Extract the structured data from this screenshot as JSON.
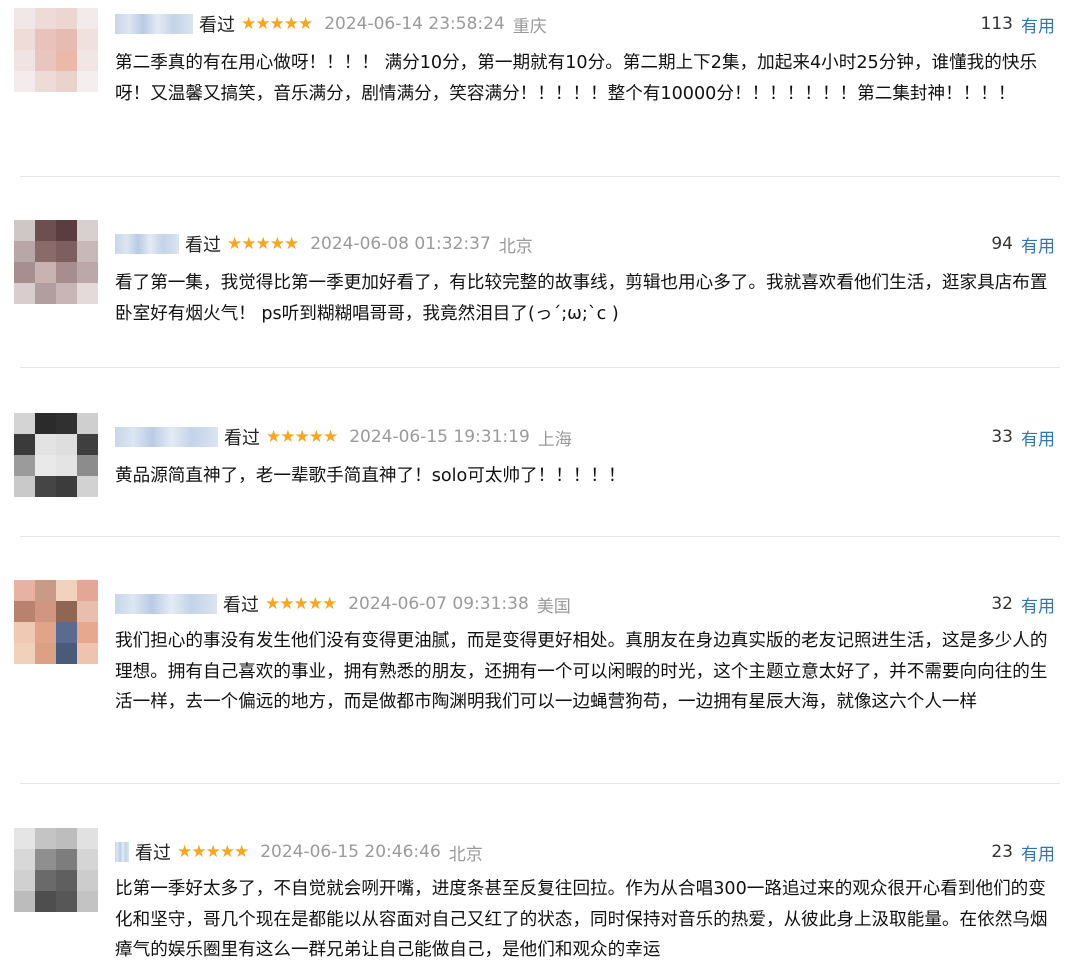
{
  "reviews": [
    {
      "watched_label": "看过",
      "stars": "★★★★★",
      "time": "2024-06-14 23:58:24",
      "location": "重庆",
      "vote_count": "113",
      "useful_label": "有用",
      "content": "第二季真的有在用心做呀！！！！ 满分10分，第一期就有10分。第二期上下2集，加起来4小时25分钟，谁懂我的快乐呀！又温馨又搞笑，音乐满分，剧情满分，笑容满分！！！！！整个有10000分！！！！！！！第二集封神！！！！"
    },
    {
      "watched_label": "看过",
      "stars": "★★★★★",
      "time": "2024-06-08 01:32:37",
      "location": "北京",
      "vote_count": "94",
      "useful_label": "有用",
      "content": "看了第一集，我觉得比第一季更加好看了，有比较完整的故事线，剪辑也用心多了。我就喜欢看他们生活，逛家具店布置卧室好有烟火气！ ps听到糊糊唱哥哥，我竟然泪目了(っ´;ω;`c )"
    },
    {
      "watched_label": "看过",
      "stars": "★★★★★",
      "time": "2024-06-15 19:31:19",
      "location": "上海",
      "vote_count": "33",
      "useful_label": "有用",
      "content": "黄品源简直神了，老一辈歌手简直神了！solo可太帅了！！！！！"
    },
    {
      "watched_label": "看过",
      "stars": "★★★★★",
      "time": "2024-06-07 09:31:38",
      "location": "美国",
      "vote_count": "32",
      "useful_label": "有用",
      "content": "我们担心的事没有发生他们没有变得更油腻，而是变得更好相处。真朋友在身边真实版的老友记照进生活，这是多少人的理想。拥有自己喜欢的事业，拥有熟悉的朋友，还拥有一个可以闲暇的时光，这个主题立意太好了，并不需要向向往的生活一样，去一个偏远的地方，而是做都市陶渊明我们可以一边蝇营狗苟，一边拥有星辰大海，就像这六个人一样"
    },
    {
      "watched_label": "看过",
      "stars": "★★★★★",
      "time": "2024-06-15 20:46:46",
      "location": "北京",
      "vote_count": "23",
      "useful_label": "有用",
      "content": "比第一季好太多了，不自觉就会咧开嘴，进度条甚至反复往回拉。作为从合唱300一路追过来的观众很开心看到他们的变化和坚守，哥几个现在是都能以从容面对自己又红了的状态，同时保持对音乐的热爱，从彼此身上汲取能量。在依然乌烟瘴气的娱乐圈里有这么一群兄弟让自己能做自己，是他们和观众的幸运"
    }
  ],
  "colors": {
    "star": "#f5a623",
    "useful_link": "#3377aa",
    "meta_gray": "#9a9a9a",
    "divider": "#e6e6e6"
  }
}
